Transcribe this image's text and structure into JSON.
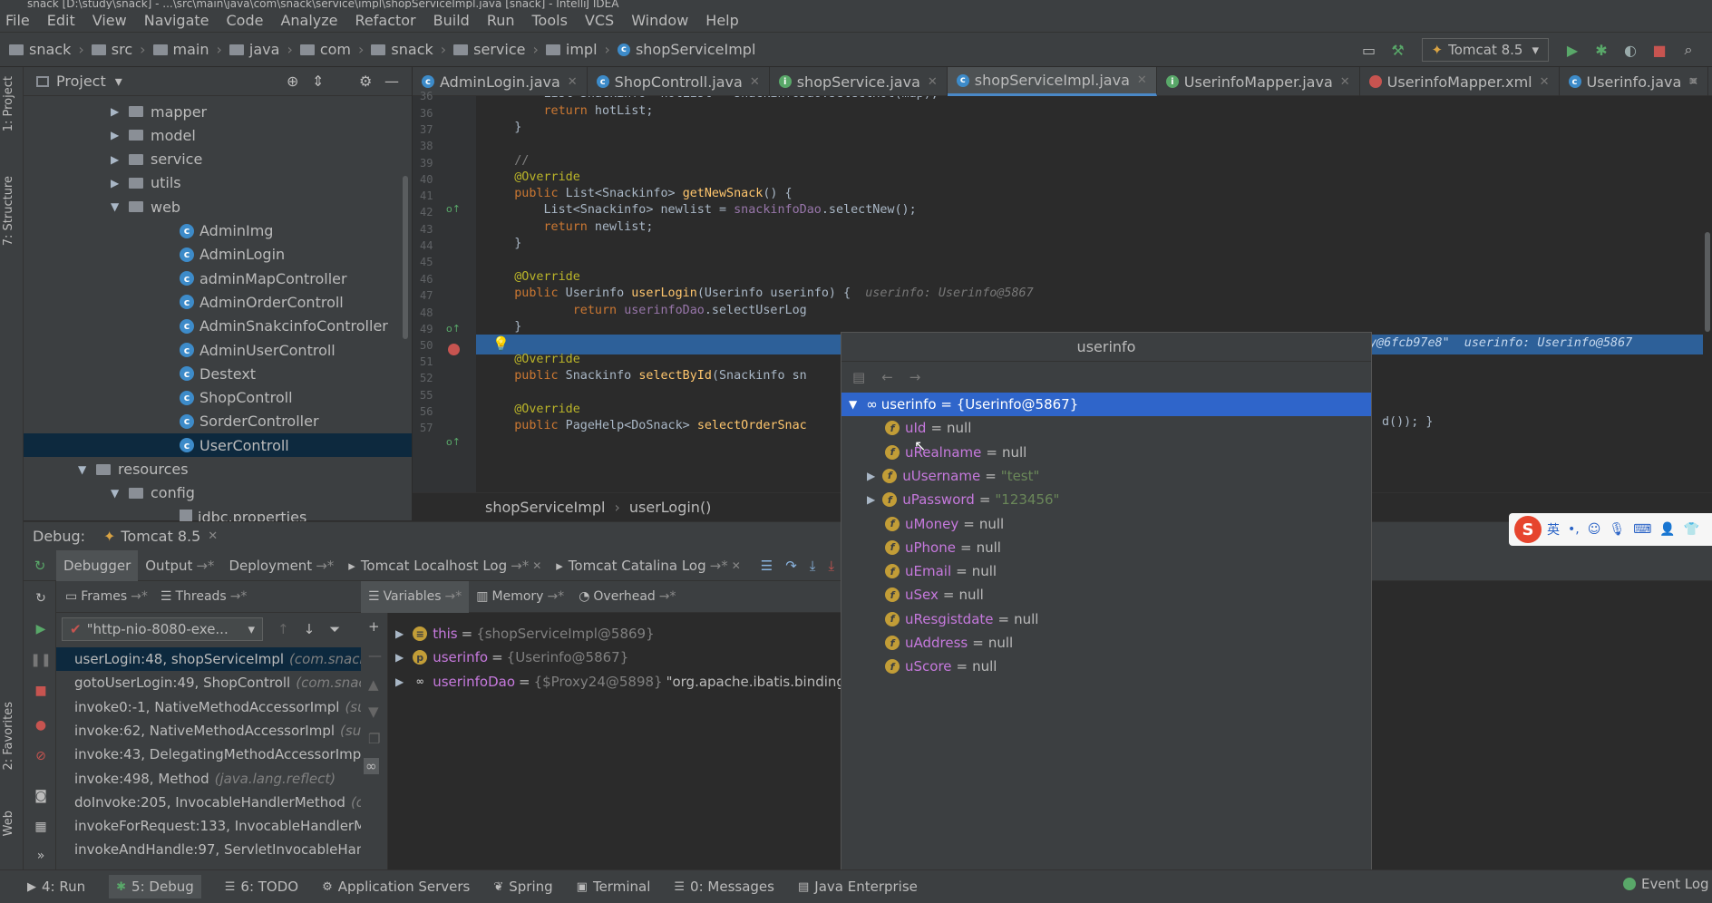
{
  "titlebar": {
    "text": "snack [D:\\study\\snack] - ...\\src\\main\\java\\com\\snack\\service\\impl\\shopServiceImpl.java [snack] - IntelliJ IDEA"
  },
  "menu": [
    "File",
    "Edit",
    "View",
    "Navigate",
    "Code",
    "Analyze",
    "Refactor",
    "Build",
    "Run",
    "Tools",
    "VCS",
    "Window",
    "Help"
  ],
  "breadcrumbs": [
    "snack",
    "src",
    "main",
    "java",
    "com",
    "snack",
    "service",
    "impl",
    "shopServiceImpl"
  ],
  "run_config": "Tomcat 8.5",
  "left_strip": {
    "project": "1: Project",
    "structure": "7: Structure",
    "favorites": "2: Favorites",
    "web": "Web"
  },
  "project": {
    "title": "Project",
    "tree": [
      {
        "label": "mapper",
        "type": "folder",
        "indent": 1,
        "expanded": false
      },
      {
        "label": "model",
        "type": "folder",
        "indent": 1,
        "expanded": false
      },
      {
        "label": "service",
        "type": "folder",
        "indent": 1,
        "expanded": false
      },
      {
        "label": "utils",
        "type": "folder",
        "indent": 1,
        "expanded": false
      },
      {
        "label": "web",
        "type": "folder",
        "indent": 1,
        "expanded": true
      },
      {
        "label": "AdminImg",
        "type": "class",
        "indent": 2
      },
      {
        "label": "AdminLogin",
        "type": "class",
        "indent": 2
      },
      {
        "label": "adminMapController",
        "type": "class",
        "indent": 2
      },
      {
        "label": "AdminOrderControll",
        "type": "class",
        "indent": 2
      },
      {
        "label": "AdminSnakcinfoController",
        "type": "class",
        "indent": 2
      },
      {
        "label": "AdminUserControll",
        "type": "class",
        "indent": 2
      },
      {
        "label": "Destext",
        "type": "class",
        "indent": 2
      },
      {
        "label": "ShopControll",
        "type": "class",
        "indent": 2
      },
      {
        "label": "SorderController",
        "type": "class",
        "indent": 2
      },
      {
        "label": "UserControll",
        "type": "class",
        "indent": 2,
        "selected": true
      },
      {
        "label": "resources",
        "type": "folder",
        "indent": 0,
        "expanded": true
      },
      {
        "label": "config",
        "type": "folder",
        "indent": 1,
        "expanded": true
      },
      {
        "label": "jdbc.properties",
        "type": "file",
        "indent": 2
      }
    ]
  },
  "editor_tabs": [
    {
      "label": "AdminLogin.java",
      "icon": "C"
    },
    {
      "label": "ShopControll.java",
      "icon": "C"
    },
    {
      "label": "shopService.java",
      "icon": "I"
    },
    {
      "label": "shopServiceImpl.java",
      "icon": "C",
      "active": true
    },
    {
      "label": "UserinfoMapper.java",
      "icon": "I"
    },
    {
      "label": "UserinfoMapper.xml",
      "icon": "X"
    },
    {
      "label": "Userinfo.java",
      "icon": "C"
    }
  ],
  "code_lines": [
    {
      "n": "36",
      "html": "        <span>List&lt;Snackinfo&gt; hotList = snackinfoDao.selectHot(map);</span>"
    },
    {
      "n": "36",
      "html": "        <span class='kw'>return</span> hotList;"
    },
    {
      "n": "37",
      "html": "    }"
    },
    {
      "n": "38",
      "html": ""
    },
    {
      "n": "39",
      "html": "    <span class='cmt'>//</span>"
    },
    {
      "n": "40",
      "html": "    <span class='ann'>@Override</span>"
    },
    {
      "n": "41",
      "html": "    <span class='kw'>public</span> List&lt;Snackinfo&gt; <span class='fn'>getNewSnack</span>() {"
    },
    {
      "n": "42",
      "html": "        List&lt;Snackinfo&gt; newlist = <span class='fld'>snackinfoDao</span>.selectNew();"
    },
    {
      "n": "43",
      "html": "        <span class='kw'>return</span> newlist;"
    },
    {
      "n": "44",
      "html": "    }"
    },
    {
      "n": "45",
      "html": ""
    },
    {
      "n": "46",
      "html": "    <span class='ann'>@Override</span>"
    },
    {
      "n": "47",
      "html": "    <span class='kw'>public</span> Userinfo <span class='fn'>userLogin</span>(Userinfo userinfo) {  <span class='hint'>userinfo: Userinfo@5867</span>"
    },
    {
      "n": "48",
      "html": "            <span class='kw'>return</span> <span class='fld'>userinfoDao</span>.selectUserLog"
    },
    {
      "n": "49",
      "html": "    }"
    },
    {
      "n": "50",
      "html": ""
    },
    {
      "n": "51",
      "html": "    <span class='ann'>@Override</span>"
    },
    {
      "n": "52",
      "html": "    <span class='kw'>public</span> Snackinfo <span class='fn'>selectById</span>(Snackinfo sn"
    },
    {
      "n": "55",
      "html": ""
    },
    {
      "n": "56",
      "html": "    <span class='ann'>@Override</span>"
    },
    {
      "n": "57",
      "html": "    <span class='kw'>public</span> PageHelp&lt;DoSnack&gt; <span class='fn'>selectOrderSnac</span>"
    }
  ],
  "line48_right_hint": "y@6fcb97e8\"  userinfo: Userinfo@5867",
  "line52_right": "d()); }",
  "editor_breadcrumb": [
    "shopServiceImpl",
    "userLogin()"
  ],
  "debug": {
    "label": "Debug:",
    "session": "Tomcat 8.5",
    "tabs": [
      "Debugger",
      "Output",
      "Deployment",
      "Tomcat Localhost Log",
      "Tomcat Catalina Log"
    ],
    "frames_tab": "Frames",
    "threads_tab": "Threads",
    "thread": "\"http-nio-8080-exe...",
    "frames": [
      {
        "method": "userLogin:48, shopServiceImpl",
        "pkg": "(com.snack.",
        "selected": true
      },
      {
        "method": "gotoUserLogin:49, ShopControll",
        "pkg": "(com.snac"
      },
      {
        "method": "invoke0:-1, NativeMethodAccessorImpl",
        "pkg": "(su"
      },
      {
        "method": "invoke:62, NativeMethodAccessorImpl",
        "pkg": "(sun"
      },
      {
        "method": "invoke:43, DelegatingMethodAccessorImp",
        "pkg": ""
      },
      {
        "method": "invoke:498, Method",
        "pkg": "(java.lang.reflect)"
      },
      {
        "method": "doInvoke:205, InvocableHandlerMethod",
        "pkg": "(c"
      },
      {
        "method": "invokeForRequest:133, InvocableHandlerM",
        "pkg": ""
      },
      {
        "method": "invokeAndHandle:97, ServletInvocableHan",
        "pkg": ""
      }
    ],
    "vars_tabs": [
      "Variables",
      "Memory",
      "Overhead"
    ],
    "variables": [
      {
        "name": "this",
        "value": "{shopServiceImpl@5869}",
        "extra": ""
      },
      {
        "name": "userinfo",
        "value": "{Userinfo@5867}",
        "extra": ""
      },
      {
        "name": "userinfoDao",
        "value": "{$Proxy24@5898}",
        "extra": "\"org.apache.ibatis.binding.M"
      }
    ]
  },
  "popup": {
    "title": "userinfo",
    "root": "userinfo = {Userinfo@5867}",
    "fields": [
      {
        "name": "uId",
        "value": "null",
        "expandable": false
      },
      {
        "name": "uRealname",
        "value": "null",
        "expandable": false
      },
      {
        "name": "uUsername",
        "value": "\"test\"",
        "expandable": true,
        "str": true
      },
      {
        "name": "uPassword",
        "value": "\"123456\"",
        "expandable": true,
        "str": true
      },
      {
        "name": "uMoney",
        "value": "null",
        "expandable": false
      },
      {
        "name": "uPhone",
        "value": "null",
        "expandable": false
      },
      {
        "name": "uEmail",
        "value": "null",
        "expandable": false
      },
      {
        "name": "uSex",
        "value": "null",
        "expandable": false
      },
      {
        "name": "uResgistdate",
        "value": "null",
        "expandable": false
      },
      {
        "name": "uAddress",
        "value": "null",
        "expandable": false
      },
      {
        "name": "uScore",
        "value": "null",
        "expandable": false
      }
    ]
  },
  "ime": {
    "lang": "英",
    "punct": "•,"
  },
  "statusbar": {
    "tools": [
      "4: Run",
      "5: Debug",
      "6: TODO",
      "Application Servers",
      "Spring",
      "Terminal",
      "0: Messages",
      "Java Enterprise"
    ],
    "event_log": "Event Log"
  },
  "colors": {
    "accent": "#4a88c7",
    "selection": "#2f65ca",
    "breakpoint": "#c75450"
  }
}
